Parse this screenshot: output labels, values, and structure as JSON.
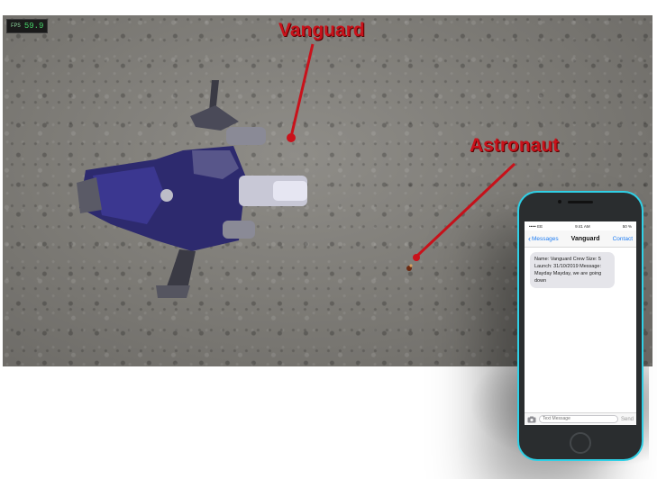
{
  "viewport": {
    "fps_label": "FPS",
    "fps_value": "59.9",
    "callouts": {
      "vanguard": "Vanguard",
      "astronaut": "Astronaut"
    },
    "callout_color": "#c9121b"
  },
  "phone": {
    "frame_color": "#2fd0e6",
    "status": {
      "carrier": "••••• EE",
      "time": "9:41 AM",
      "battery": "50 %"
    },
    "nav": {
      "back_label": "Messages",
      "title": "Vanguard",
      "action_label": "Contact"
    },
    "message": "Name: Vanguard Crew Size: 5 Launch: 31/10/2019 Message: Mayday Mayday, we are going down",
    "input_placeholder": "Text Message",
    "send_label": "Send",
    "accent_color": "#1e7cf2"
  }
}
